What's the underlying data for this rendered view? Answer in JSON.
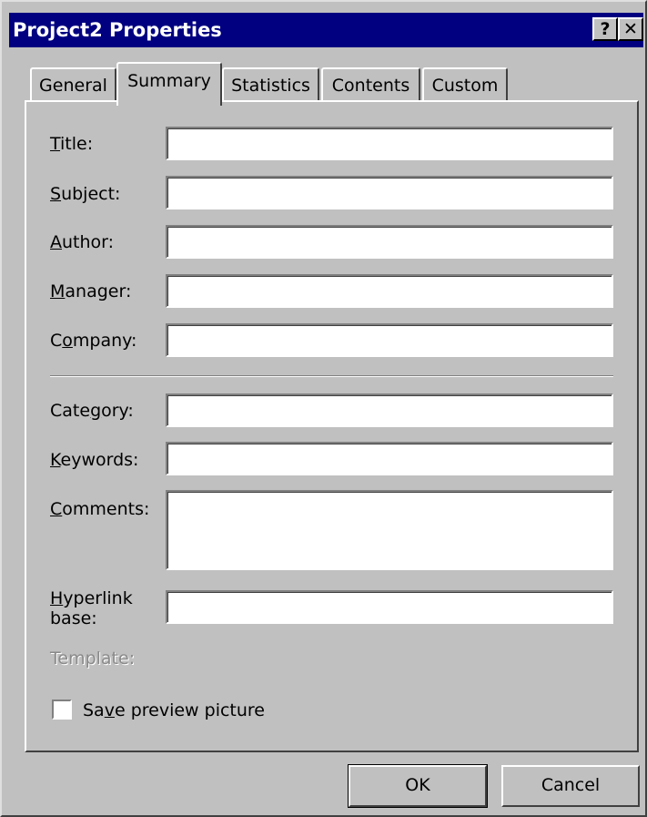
{
  "window": {
    "title": "Project2 Properties",
    "help_label": "?",
    "close_label": "✕"
  },
  "tabs": [
    {
      "label": "General",
      "active": false
    },
    {
      "label": "Summary",
      "active": true
    },
    {
      "label": "Statistics",
      "active": false
    },
    {
      "label": "Contents",
      "active": false
    },
    {
      "label": "Custom",
      "active": false
    }
  ],
  "fields": {
    "title": {
      "pre": "",
      "key": "T",
      "post": "itle:",
      "value": ""
    },
    "subject": {
      "pre": "",
      "key": "S",
      "post": "ubject:",
      "value": ""
    },
    "author": {
      "pre": "",
      "key": "A",
      "post": "uthor:",
      "value": ""
    },
    "manager": {
      "pre": "",
      "key": "M",
      "post": "anager:",
      "value": ""
    },
    "company": {
      "pre": "C",
      "key": "o",
      "post": "mpany:",
      "value": ""
    },
    "category": {
      "pre": "Cate",
      "key": "g",
      "post": "ory:",
      "value": ""
    },
    "keywords": {
      "pre": "",
      "key": "K",
      "post": "eywords:",
      "value": ""
    },
    "comments": {
      "pre": "",
      "key": "C",
      "post": "omments:",
      "value": ""
    },
    "hyperlink_base": {
      "pre": "",
      "key": "H",
      "post": "yperlink",
      "line2": "base:",
      "value": ""
    }
  },
  "template": {
    "label": "Template:",
    "value": ""
  },
  "save_preview": {
    "pre": "Sa",
    "key": "v",
    "post": "e preview picture",
    "checked": false
  },
  "buttons": {
    "ok": "OK",
    "cancel": "Cancel"
  },
  "colors": {
    "titlebar": "#000080",
    "face": "#c0c0c0",
    "field": "#ffffff"
  }
}
